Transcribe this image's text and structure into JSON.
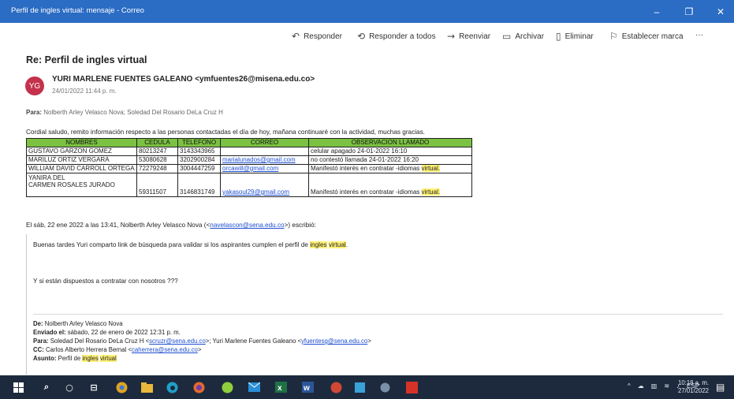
{
  "window": {
    "title": "Perfil de ingles virtual: mensaje - Correo",
    "minimize": "–",
    "maximize": "❐",
    "close": "✕"
  },
  "toolbar": {
    "reply": "Responder",
    "reply_all": "Responder a todos",
    "forward": "Reenviar",
    "archive": "Archivar",
    "delete": "Eliminar",
    "flag": "Establecer marca",
    "more": "···"
  },
  "message": {
    "subject": "Re: Perfil de ingles virtual",
    "avatar_initials": "YG",
    "sender": "YURI MARLENE FUENTES GALEANO <ymfuentes26@misena.edu.co>",
    "date": "24/01/2022 11:44 p. m.",
    "to_label": "Para:",
    "to": "Nolberth Arley Velasco Nova; Soledad Del Rosario DeLa Cruz H",
    "greeting": "Cordial saludo, remito información respecto a las personas contactadas el día de hoy, mañana continuaré con la actividad, muchas gracias."
  },
  "table": {
    "headers": [
      "NOMBRES",
      "CEDULA",
      "TELEFONO",
      "CORREO",
      "OBSERVACION LLAMADO"
    ],
    "rows": [
      {
        "name": "GUSTAVO GARZON GOMEZ",
        "cedula": "80213247",
        "telefono": "3143343965",
        "correo": "",
        "obs": "celular apagado 24-01-2022 16:10",
        "obs_hl": ""
      },
      {
        "name": "MARILUZ ORTIZ VERGARA",
        "cedula": "53080628",
        "telefono": "3202900284",
        "correo": "marialunados@gmail.com",
        "obs": "no contestó llamada 24-01-2022 16:20",
        "obs_hl": ""
      },
      {
        "name": "WILLIAM DAVID CARROLL ORTEGA",
        "cedula": "72279248",
        "telefono": "3004447259",
        "correo": "orcawill@gmail.com",
        "obs": "Manifestó interés en contratar -idiomas ",
        "obs_hl": "virtual."
      },
      {
        "name": "YANIRA DEL",
        "name2": "CARMEN ROSALES JURADO",
        "cedula": "59311507",
        "telefono": "3146831749",
        "correo": "yakasoul29@gmail.com",
        "obs": "Manifestó interés en contratar -idiomas ",
        "obs_hl": "virtual."
      }
    ]
  },
  "quote": {
    "intro_pre": "El sáb, 22 ene 2022 a las 13:41, Nolberth Arley Velasco Nova (<",
    "intro_link": "navelascon@sena.edu.co",
    "intro_post": ">) escribió:",
    "body1_pre": "Buenas tardes Yuri comparto link de búsqueda para validar si los aspirantes cumplen el perfil de ",
    "body1_hl1": "ingles",
    "body1_hl2": "virtual",
    "body1_post": ".",
    "body2": "Y si están dispuestos a contratar con nosotros ???",
    "from_label": "De:",
    "from": "Nolberth Arley Velasco Nova",
    "sent_label": "Enviado el:",
    "sent": "sábado, 22 de enero de 2022 12:31 p. m.",
    "para_label": "Para:",
    "para_pre": "Soledad Del Rosario DeLa Cruz H <",
    "para_link1": "scruzr@sena.edu.co",
    "para_mid": ">; Yuri Marlene Fuentes Galeano <",
    "para_link2": "yfuentesg@sena.edu.co",
    "para_post": ">",
    "cc_label": "CC:",
    "cc_pre": "Carlos Alberto Herrera Bernal <",
    "cc_link": "caherrera@sena.edu.co",
    "cc_post": ">",
    "asunto_label": "Asunto:",
    "asunto_pre": "Perfil de ",
    "asunto_hl1": "ingles",
    "asunto_hl2": "virtual"
  },
  "taskbar": {
    "tray_language": "ESP",
    "time": "10:18 a. m.",
    "date": "27/01/2022"
  },
  "colors": {
    "titlebar": "#2b6cc4",
    "table_header": "#7bc142",
    "highlight": "#fff176",
    "link": "#1f4fd1",
    "taskbar": "#1d2a3d",
    "avatar": "#c4314b"
  },
  "icons": [
    "reply-icon",
    "reply-all-icon",
    "forward-icon",
    "archive-icon",
    "delete-icon",
    "flag-icon",
    "windows-icon",
    "search-icon",
    "cortana-icon",
    "task-view-icon",
    "chrome-icon",
    "file-explorer-icon",
    "edge-icon",
    "firefox-icon",
    "word-icon",
    "excel-icon",
    "acrobat-icon"
  ]
}
